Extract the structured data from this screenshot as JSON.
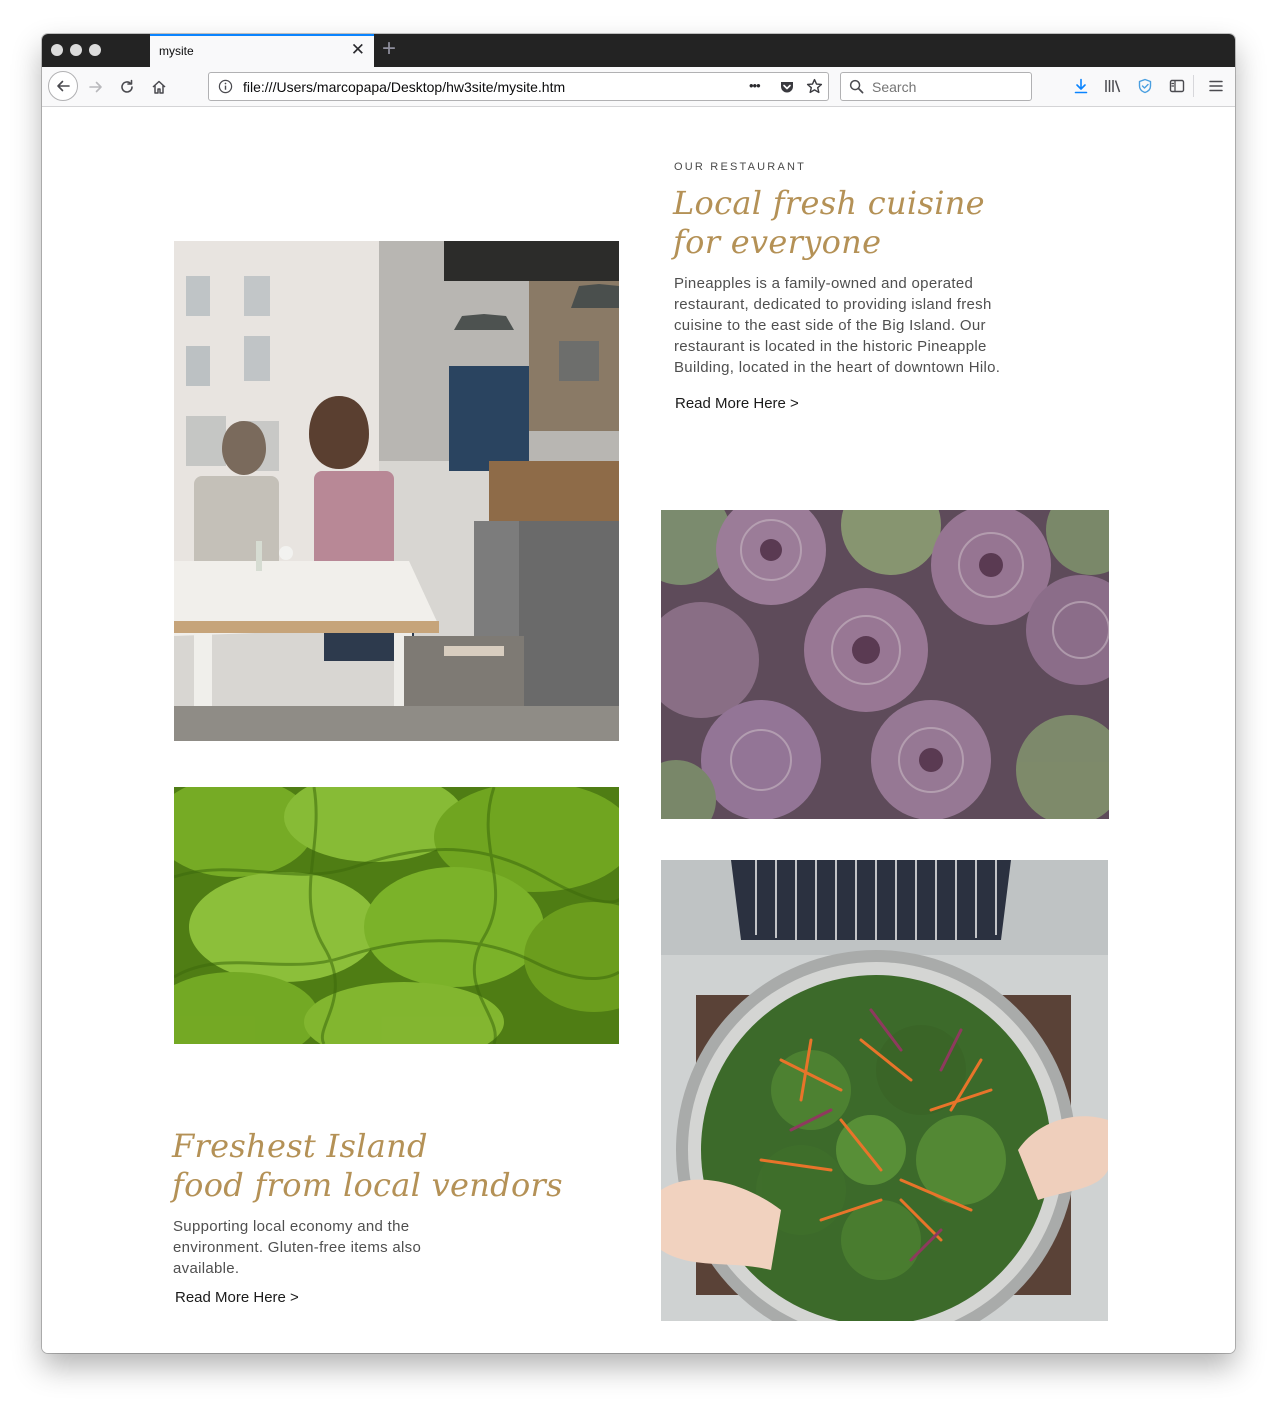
{
  "browser": {
    "tab_title": "mysite",
    "close_glyph": "✕",
    "newtab_glyph": "+",
    "url": "file:///Users/marcopapa/Desktop/hw3site/mysite.htm",
    "page_actions_glyph": "•••",
    "search_placeholder": "Search",
    "icons": [
      "back-icon",
      "forward-icon",
      "reload-icon",
      "home-icon",
      "info-icon",
      "pocket-icon",
      "bookmark-star-icon",
      "search-icon",
      "download-icon",
      "library-icon",
      "shield-icon",
      "sidebar-icon",
      "hamburger-menu-icon"
    ],
    "colors": {
      "accent": "#0a84ff",
      "tabbar": "#232323",
      "toolbar": "#f9f9fa"
    }
  },
  "page": {
    "eyebrow": "OUR RESTAURANT",
    "intro": {
      "heading_line1": "Local fresh cuisine",
      "heading_line2": "for everyone",
      "body": "Pineapples is a family-owned and operated restaurant, dedicated to providing island fresh cuisine to the east side of the Big Island. Our restaurant is located in the historic Pineapple Building, located in the heart of downtown Hilo.",
      "link": "Read More Here >"
    },
    "vendors": {
      "heading_line1": "Freshest Island",
      "heading_line2": "food from local vendors",
      "body": "Supporting local economy and the environment. Gluten-free items also available.",
      "link": "Read More Here >"
    },
    "colors": {
      "heading": "#b49156",
      "body": "#4f4f4f"
    },
    "images": [
      "cafe-interior-photo",
      "artichokes-photo",
      "lettuce-photo",
      "kale-salad-bowl-photo"
    ]
  }
}
